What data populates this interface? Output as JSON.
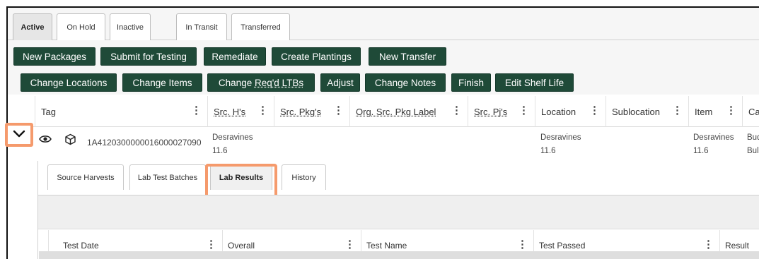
{
  "status_tabs": [
    "Active",
    "On Hold",
    "Inactive",
    "In Transit",
    "Transferred"
  ],
  "toolbar": {
    "row1": [
      "New Packages",
      "Submit for Testing",
      "Remediate",
      "Create Plantings",
      "New Transfer"
    ],
    "row2": [
      "Change Locations",
      "Change Items",
      "Change ",
      "Req'd LTBs",
      "Adjust",
      "Change Notes",
      "Finish",
      "Edit Shelf Life"
    ]
  },
  "grid": {
    "columns": [
      "Tag",
      "Src. H's",
      "Src. Pkg's",
      "Org. Src. Pkg Label",
      "Src. Pj's",
      "Location",
      "Sublocation",
      "Item",
      "Ca"
    ],
    "row": {
      "tag": "1A4120300000016000027090",
      "src_harvest": [
        "Desravines",
        "11.6"
      ],
      "location": [
        "Desravines",
        "11.6"
      ],
      "item": [
        "Desravines",
        "11.6"
      ],
      "category": [
        "Bud",
        "Bul"
      ]
    }
  },
  "detail_tabs": [
    "Source Harvests",
    "Lab Test Batches",
    "Lab Results",
    "History"
  ],
  "lab_results_columns": [
    "Test Date",
    "Overall",
    "Test Name",
    "Test Passed",
    "Result"
  ],
  "colors": {
    "button": "#1f4a38",
    "highlight": "#f59a6c"
  },
  "icons": {
    "expand": "chevron-down-icon",
    "view": "eye-icon",
    "package": "box-icon",
    "menu": "kebab-icon"
  }
}
